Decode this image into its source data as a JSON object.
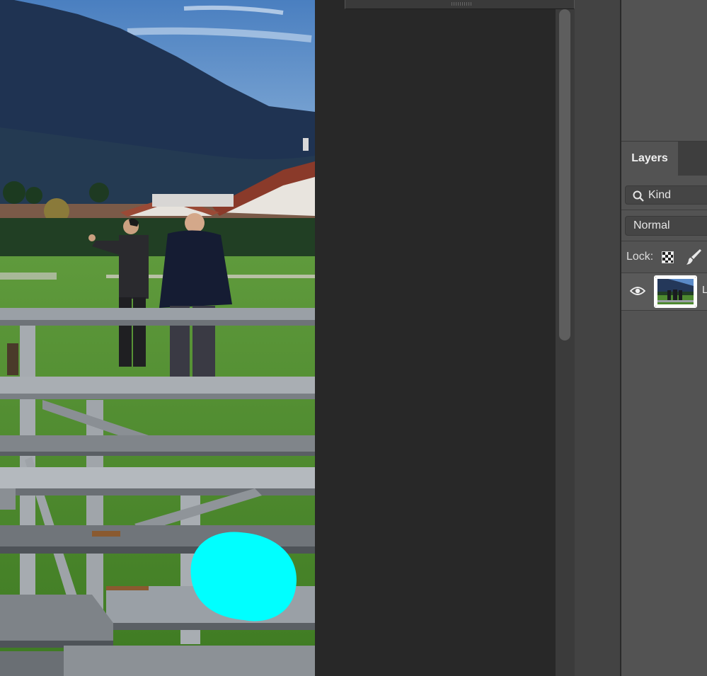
{
  "layers_panel": {
    "tab_label": "Layers",
    "filter_kind_label": "Kind",
    "blend_mode": "Normal",
    "lock_label": "Lock:",
    "layer_name_partial": "L"
  },
  "icons": {
    "search": "search-icon",
    "lock_transparent": "checkerboard-lock-icon",
    "lock_paint": "brush-lock-icon",
    "visibility": "eye-icon"
  },
  "colors": {
    "canvas_bg": "#282828",
    "panel_bg": "#535353",
    "brush_stroke": "#00ffff"
  }
}
